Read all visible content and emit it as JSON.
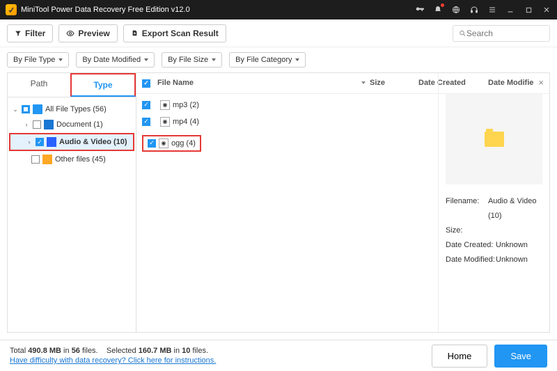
{
  "titlebar": {
    "title": "MiniTool Power Data Recovery Free Edition v12.0"
  },
  "toolbar": {
    "filter": "Filter",
    "preview": "Preview",
    "export": "Export Scan Result",
    "search_placeholder": "Search"
  },
  "filters": {
    "by_type": "By File Type",
    "by_date": "By Date Modified",
    "by_size": "By File Size",
    "by_cat": "By File Category"
  },
  "tabs": {
    "path": "Path",
    "type": "Type"
  },
  "tree": {
    "all": "All File Types (56)",
    "document": "Document (1)",
    "audio_video": "Audio & Video (10)",
    "other": "Other files (45)"
  },
  "columns": {
    "filename": "File Name",
    "size": "Size",
    "date_created": "Date Created",
    "date_modified": "Date Modifie"
  },
  "rows": [
    {
      "name": "mp3 (2)"
    },
    {
      "name": "mp4 (4)"
    },
    {
      "name": "ogg (4)"
    }
  ],
  "preview": {
    "filename_label": "Filename:",
    "filename_value": "Audio & Video (10)",
    "size_label": "Size:",
    "size_value": "",
    "dc_label": "Date Created:",
    "dc_value": "Unknown",
    "dm_label": "Date Modified:",
    "dm_value": "Unknown"
  },
  "footer": {
    "total_prefix": "Total ",
    "total_size": "490.8 MB",
    "total_mid": " in ",
    "total_files": "56",
    "total_suffix": " files.",
    "sel_prefix": "Selected ",
    "sel_size": "160.7 MB",
    "sel_mid": " in ",
    "sel_files": "10",
    "sel_suffix": " files.",
    "help": "Have difficulty with data recovery? Click here for instructions.",
    "home": "Home",
    "save": "Save"
  }
}
